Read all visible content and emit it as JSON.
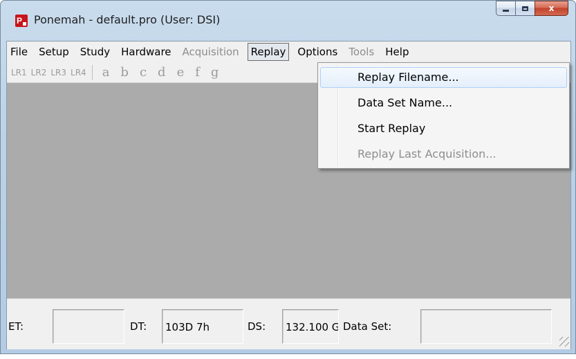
{
  "window": {
    "title": "Ponemah - default.pro (User: DSI)",
    "app_icon_letter": "P",
    "close_glyph": "x"
  },
  "menubar": {
    "items": [
      {
        "label": "File",
        "state": "enabled"
      },
      {
        "label": "Setup",
        "state": "enabled"
      },
      {
        "label": "Study",
        "state": "enabled"
      },
      {
        "label": "Hardware",
        "state": "enabled"
      },
      {
        "label": "Acquisition",
        "state": "disabled"
      },
      {
        "label": "Replay",
        "state": "open"
      },
      {
        "label": "Options",
        "state": "enabled"
      },
      {
        "label": "Tools",
        "state": "disabled"
      },
      {
        "label": "Help",
        "state": "enabled"
      }
    ]
  },
  "toolbar": {
    "lr_buttons": [
      "LR1",
      "LR2",
      "LR3",
      "LR4"
    ],
    "letters": [
      "a",
      "b",
      "c",
      "d",
      "e",
      "f",
      "g"
    ]
  },
  "replay_menu": {
    "items": [
      {
        "label": "Replay Filename...",
        "state": "hover"
      },
      {
        "label": "Data Set Name...",
        "state": "enabled"
      },
      {
        "label": "Start Replay",
        "state": "enabled"
      },
      {
        "label": "Replay Last Acquisition...",
        "state": "disabled"
      }
    ]
  },
  "statusbar": {
    "et_label": "ET:",
    "et_value": "",
    "dt_label": "DT:",
    "dt_value": "103D 7h",
    "ds_label": "DS:",
    "ds_value": "132.100 G",
    "dataset_label": "Data Set:",
    "dataset_value": ""
  },
  "colors": {
    "workspace": "#ababab",
    "disabled_text": "#8d8d8d",
    "close_button": "#c2432c"
  }
}
